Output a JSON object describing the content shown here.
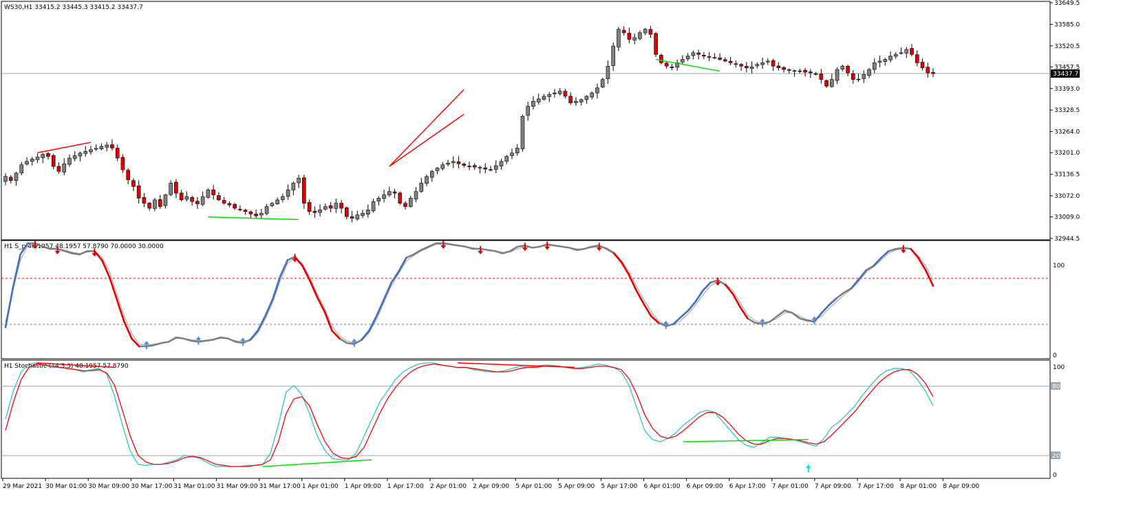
{
  "colors": {
    "bull": "#808080",
    "bear": "#e00000",
    "wick": "#000000",
    "border": "#000000",
    "bid_line": "#9aa7b0",
    "price_tag_bg": "#000000",
    "price_tag_fg": "#ffffff",
    "trend_red": "#ff0000",
    "trend_green": "#00e000",
    "s_main": "#7a8088",
    "s_signal": "#7a8088",
    "s_up_seg": "#4472c4",
    "s_down_seg": "#ee0000",
    "s_upper_level": "#ff0000",
    "s_lower_level": "#7a7a7a",
    "stoch_main": "#2ec4c4",
    "stoch_signal": "#ff0000",
    "stoch_level": "#9aa7b0",
    "arrow_up": "#5b8bd6",
    "arrow_down": "#e00000",
    "arrow_cyan": "#00e5e5"
  },
  "price_panel": {
    "header": "WS30,H1  33415.2 33445.3 33415.2 33437.7",
    "current_price": "33437.7",
    "axis_labels": [
      "33649.5",
      "33585.0",
      "33520.5",
      "33457.5",
      "33393.0",
      "33328.5",
      "33264.0",
      "33201.0",
      "33136.5",
      "33072.0",
      "33009.0",
      "32944.5"
    ]
  },
  "s_panel": {
    "header": "H1 S_p 46.1957 48.1957 57.8790 70.0000 30.0000",
    "axis_labels": [
      "100",
      "0"
    ]
  },
  "stoch_panel": {
    "header": "H1 Stochastic (14,3,3) 48.1957 57.8790",
    "axis_labels": [
      "100",
      "0"
    ],
    "level_tags": [
      "80",
      "20"
    ]
  },
  "time_axis": [
    "29 Mar 2021",
    "30 Mar 01:00",
    "30 Mar 09:00",
    "30 Mar 17:00",
    "31 Mar 01:00",
    "31 Mar 09:00",
    "31 Mar 17:00",
    "1 Apr 01:00",
    "1 Apr 09:00",
    "1 Apr 17:00",
    "2 Apr 01:00",
    "2 Apr 09:00",
    "5 Apr 01:00",
    "5 Apr 09:00",
    "5 Apr 17:00",
    "6 Apr 01:00",
    "6 Apr 09:00",
    "6 Apr 17:00",
    "7 Apr 01:00",
    "7 Apr 09:00",
    "7 Apr 17:00",
    "8 Apr 01:00",
    "8 Apr 09:00"
  ],
  "chart_data": {
    "type": "candlestick",
    "symbol": "WS30",
    "timeframe": "H1",
    "ylim": [
      32944.5,
      33649.5
    ],
    "close_series": [
      33130,
      33118,
      33140,
      33165,
      33175,
      33182,
      33188,
      33196,
      33190,
      33160,
      33145,
      33168,
      33185,
      33192,
      33200,
      33205,
      33210,
      33214,
      33220,
      33224,
      33215,
      33185,
      33150,
      33120,
      33100,
      33065,
      33050,
      33035,
      33060,
      33040,
      33075,
      33110,
      33080,
      33060,
      33070,
      33055,
      33048,
      33070,
      33090,
      33075,
      33060,
      33050,
      33045,
      33035,
      33030,
      33025,
      33018,
      33012,
      33020,
      33040,
      33050,
      33060,
      33070,
      33090,
      33110,
      33125,
      33050,
      33025,
      33022,
      33030,
      33040,
      33035,
      33050,
      33035,
      33010,
      33005,
      33015,
      33020,
      33030,
      33055,
      33065,
      33075,
      33085,
      33080,
      33050,
      33040,
      33065,
      33085,
      33110,
      33130,
      33145,
      33155,
      33165,
      33170,
      33175,
      33168,
      33163,
      33160,
      33158,
      33155,
      33152,
      33150,
      33162,
      33175,
      33190,
      33200,
      33215,
      33310,
      33340,
      33355,
      33362,
      33370,
      33375,
      33380,
      33385,
      33370,
      33350,
      33355,
      33360,
      33370,
      33380,
      33395,
      33420,
      33460,
      33520,
      33570,
      33560,
      33540,
      33545,
      33560,
      33570,
      33555,
      33495,
      33470,
      33460,
      33455,
      33470,
      33480,
      33490,
      33500,
      33495,
      33490,
      33488,
      33485,
      33480,
      33475,
      33470,
      33465,
      33460,
      33455,
      33458,
      33465,
      33470,
      33475,
      33460,
      33455,
      33450,
      33448,
      33445,
      33445,
      33442,
      33440,
      33435,
      33420,
      33400,
      33420,
      33450,
      33460,
      33440,
      33420,
      33420,
      33435,
      33450,
      33470,
      33475,
      33480,
      33490,
      33495,
      33500,
      33510,
      33495,
      33470,
      33455,
      33440,
      33437.7
    ],
    "s_main_series": [
      25,
      60,
      90,
      100,
      100,
      97,
      95,
      95,
      93,
      91,
      90,
      93,
      93,
      85,
      70,
      50,
      30,
      15,
      8,
      8,
      9,
      11,
      12,
      16,
      15,
      13,
      12,
      13,
      14,
      16,
      15,
      12,
      11,
      14,
      22,
      35,
      50,
      70,
      85,
      88,
      80,
      67,
      52,
      39,
      22,
      15,
      11,
      10,
      14,
      22,
      35,
      50,
      65,
      75,
      87,
      90,
      94,
      97,
      100,
      100,
      99,
      98,
      97,
      95,
      95,
      94,
      93,
      91,
      93,
      97,
      98,
      96,
      97,
      99,
      98,
      97,
      96,
      94,
      95,
      97,
      98,
      95,
      91,
      83,
      72,
      58,
      46,
      35,
      29,
      26,
      28,
      34,
      40,
      48,
      58,
      65,
      67,
      63,
      55,
      43,
      33,
      29,
      28,
      30,
      35,
      40,
      38,
      33,
      31,
      30,
      38,
      45,
      51,
      56,
      60,
      68,
      76,
      80,
      87,
      93,
      95,
      96,
      95,
      87,
      76,
      62
    ],
    "s_signal_series": [
      30,
      58,
      85,
      98,
      99,
      97,
      96,
      95,
      94,
      92,
      91,
      92,
      93,
      88,
      75,
      55,
      35,
      20,
      10,
      9,
      10,
      11,
      12,
      15,
      15,
      14,
      13,
      13,
      14,
      15,
      15,
      13,
      12,
      13,
      20,
      32,
      47,
      66,
      82,
      87,
      82,
      70,
      55,
      42,
      26,
      17,
      13,
      11,
      13,
      20,
      32,
      47,
      62,
      73,
      84,
      89,
      93,
      96,
      99,
      99,
      99,
      98,
      97,
      96,
      95,
      94,
      93,
      92,
      92,
      95,
      97,
      96,
      97,
      98,
      98,
      97,
      96,
      95,
      95,
      96,
      97,
      96,
      92,
      85,
      75,
      62,
      50,
      39,
      31,
      27,
      27,
      31,
      37,
      45,
      54,
      62,
      66,
      64,
      58,
      47,
      36,
      31,
      29,
      30,
      33,
      38,
      38,
      35,
      32,
      31,
      35,
      42,
      48,
      54,
      59,
      66,
      74,
      79,
      85,
      91,
      94,
      95,
      95,
      89,
      80,
      67
    ],
    "stoch_main_series": [
      50,
      75,
      92,
      99,
      100,
      98,
      96,
      96,
      95,
      94,
      92,
      94,
      95,
      90,
      70,
      45,
      22,
      10,
      9,
      10,
      10,
      12,
      14,
      18,
      17,
      15,
      11,
      8,
      8,
      8,
      8,
      9,
      9,
      10,
      20,
      45,
      74,
      80,
      72,
      55,
      35,
      22,
      15,
      14,
      14,
      20,
      35,
      50,
      65,
      75,
      85,
      92,
      96,
      99,
      100,
      100,
      98,
      97,
      96,
      96,
      94,
      93,
      92,
      92,
      93,
      95,
      97,
      96,
      97,
      98,
      98,
      97,
      96,
      95,
      96,
      97,
      99,
      98,
      96,
      92,
      80,
      60,
      40,
      32,
      30,
      33,
      38,
      45,
      50,
      56,
      58,
      56,
      48,
      40,
      32,
      27,
      25,
      29,
      34,
      34,
      33,
      32,
      30,
      28,
      26,
      33,
      43,
      48,
      55,
      62,
      72,
      80,
      88,
      93,
      95,
      95,
      93,
      85,
      75,
      62
    ],
    "stoch_signal_series": [
      40,
      65,
      85,
      96,
      99,
      98,
      97,
      96,
      95,
      94,
      93,
      93,
      94,
      91,
      80,
      58,
      35,
      18,
      12,
      10,
      10,
      11,
      13,
      16,
      17,
      16,
      13,
      10,
      9,
      8,
      8,
      8,
      9,
      10,
      14,
      30,
      55,
      68,
      70,
      62,
      45,
      30,
      20,
      16,
      15,
      17,
      25,
      40,
      55,
      68,
      78,
      86,
      92,
      96,
      98,
      99,
      98,
      97,
      96,
      96,
      95,
      94,
      93,
      92,
      92,
      93,
      95,
      96,
      96,
      97,
      97,
      97,
      96,
      95,
      95,
      96,
      97,
      97,
      96,
      94,
      86,
      72,
      54,
      42,
      35,
      33,
      35,
      40,
      46,
      52,
      56,
      56,
      52,
      45,
      37,
      31,
      28,
      28,
      31,
      33,
      33,
      32,
      31,
      29,
      28,
      30,
      36,
      43,
      50,
      57,
      66,
      74,
      82,
      88,
      92,
      94,
      94,
      90,
      82,
      70
    ]
  }
}
